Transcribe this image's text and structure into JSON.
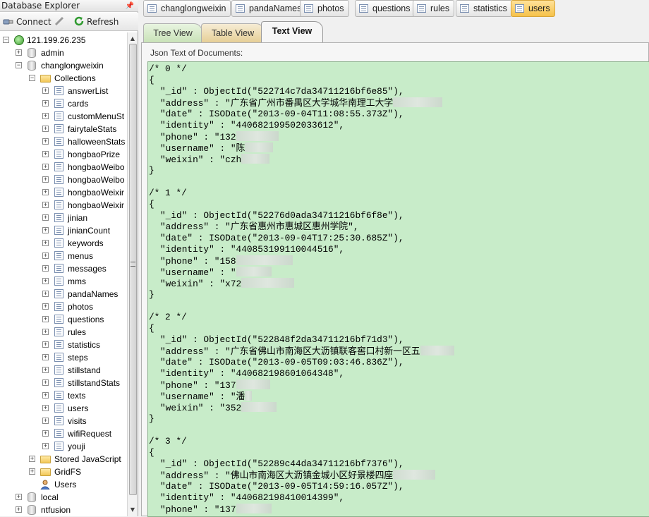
{
  "left_panel": {
    "title": "Database Explorer",
    "connect_label": "Connect",
    "refresh_label": "Refresh"
  },
  "tree": {
    "server": "121.199.26.235",
    "databases_before": [
      "admin"
    ],
    "active_db": "changlongweixin",
    "collections_label": "Collections",
    "collections": [
      "answerList",
      "cards",
      "customMenuSt",
      "fairytaleStats",
      "halloweenStats",
      "hongbaoPrize",
      "hongbaoWeibo",
      "hongbaoWeibo",
      "hongbaoWeixir",
      "hongbaoWeixir",
      "jinian",
      "jinianCount",
      "keywords",
      "menus",
      "messages",
      "mms",
      "pandaNames",
      "photos",
      "questions",
      "rules",
      "statistics",
      "steps",
      "stillstand",
      "stillstandStats",
      "texts",
      "users",
      "visits",
      "wifiRequest",
      "youji"
    ],
    "stored_js_label": "Stored JavaScript",
    "gridfs_label": "GridFS",
    "users_label": "Users",
    "databases_after": [
      "local",
      "ntfusion"
    ]
  },
  "collection_tabs": [
    "changlongweixin",
    "pandaNames",
    "photos",
    "questions",
    "rules",
    "statistics",
    "users"
  ],
  "active_collection_tab": "users",
  "view_tabs": {
    "tree": "Tree View",
    "table": "Table View",
    "text": "Text View"
  },
  "json_label": "Json Text of Documents:",
  "documents": [
    {
      "header": "/* 0 */",
      "open": "{",
      "lines": [
        "\"_id\" : ObjectId(\"522714c7da34711216bf6e85\"),",
        "\"address\" : \"广东省广州市番禺区大学城华南理工大学",
        "\"date\" : ISODate(\"2013-09-04T11:08:55.373Z\"),",
        "\"identity\" : \"440682199502033612\",",
        "\"phone\" : \"132",
        "\"username\" : \"陈",
        "\"weixin\" : \"czh"
      ],
      "close": "}"
    },
    {
      "header": "/* 1 */",
      "open": "{",
      "lines": [
        "\"_id\" : ObjectId(\"52276d0ada34711216bf6f8e\"),",
        "\"address\" : \"广东省惠州市惠城区惠州学院\",",
        "\"date\" : ISODate(\"2013-09-04T17:25:30.685Z\"),",
        "\"identity\" : \"440853199110044516\",",
        "\"phone\" : \"158",
        "\"username\" : \"",
        "\"weixin\" : \"x72"
      ],
      "close": "}"
    },
    {
      "header": "/* 2 */",
      "open": "{",
      "lines": [
        "\"_id\" : ObjectId(\"522848f2da34711216bf71d3\"),",
        "\"address\" : \"广东省佛山市南海区大沥镇联客窖口村新一区五",
        "\"date\" : ISODate(\"2013-09-05T09:03:46.836Z\"),",
        "\"identity\" : \"440682198601064348\",",
        "\"phone\" : \"137",
        "\"username\" : \"潘",
        "\"weixin\" : \"352"
      ],
      "close": "}"
    },
    {
      "header": "/* 3 */",
      "open": "{",
      "lines": [
        "\"_id\" : ObjectId(\"52289c44da34711216bf7376\"),",
        "\"address\" : \"佛山市南海区大沥镇金城小区好景楼四座",
        "\"date\" : ISODate(\"2013-09-05T14:59:16.057Z\"),",
        "\"identity\" : \"440682198410014399\",",
        "\"phone\" : \"137"
      ],
      "close": ""
    }
  ]
}
